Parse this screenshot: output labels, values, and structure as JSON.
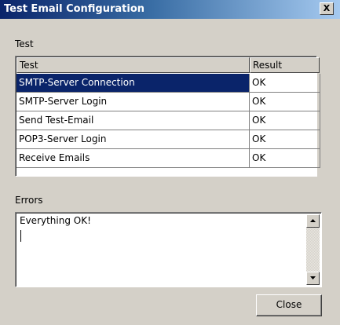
{
  "window": {
    "title": "Test Email Configuration",
    "close_glyph": "X"
  },
  "test_section": {
    "label": "Test",
    "columns": [
      "Test",
      "Result"
    ],
    "rows": [
      {
        "test": "SMTP-Server Connection",
        "result": "OK",
        "selected": true
      },
      {
        "test": "SMTP-Server Login",
        "result": "OK",
        "selected": false
      },
      {
        "test": "Send Test-Email",
        "result": "OK",
        "selected": false
      },
      {
        "test": "POP3-Server Login",
        "result": "OK",
        "selected": false
      },
      {
        "test": "Receive Emails",
        "result": "OK",
        "selected": false
      }
    ]
  },
  "errors_section": {
    "label": "Errors",
    "text": "Everything OK!"
  },
  "buttons": {
    "close_label": "Close"
  },
  "colors": {
    "title_bar_start": "#0a246a",
    "title_bar_end": "#a6caf0",
    "selection": "#0a246a",
    "dialog_face": "#d4d0c8"
  },
  "icons": {
    "scroll_up": "triangle-up-icon",
    "scroll_down": "triangle-down-icon",
    "window_close": "close-icon"
  }
}
